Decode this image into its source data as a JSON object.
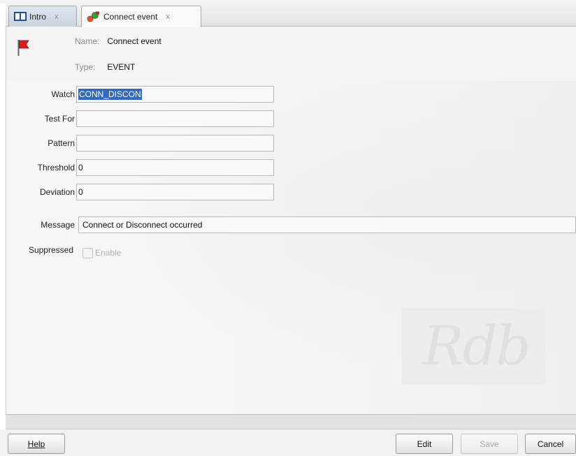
{
  "tabs": [
    {
      "label": "Intro",
      "icon": "book-icon",
      "close": "x",
      "active": false
    },
    {
      "label": "Connect event",
      "icon": "event-icon",
      "close": "x",
      "active": true
    }
  ],
  "header": {
    "icon": "red-flag-icon",
    "name_key": "Name:",
    "name_value": "Connect event",
    "type_key": "Type:",
    "type_value": "EVENT"
  },
  "form": {
    "watch_label": "Watch",
    "watch_value": "CONN_DISCON",
    "test_for_label": "Test For",
    "test_for_value": "",
    "pattern_label": "Pattern",
    "pattern_value": "",
    "threshold_label": "Threshold",
    "threshold_value": "0",
    "deviation_label": "Deviation",
    "deviation_value": "0",
    "message_label": "Message",
    "message_value": "Connect or Disconnect occurred",
    "suppressed_label": "Suppressed",
    "enable_label": "Enable",
    "enable_checked": false
  },
  "watermark": "Rdb",
  "buttons": {
    "help": "Help",
    "edit": "Edit",
    "save": "Save",
    "cancel": "Cancel"
  },
  "colors": {
    "selection": "#316ac5",
    "flag": "#d42020"
  }
}
